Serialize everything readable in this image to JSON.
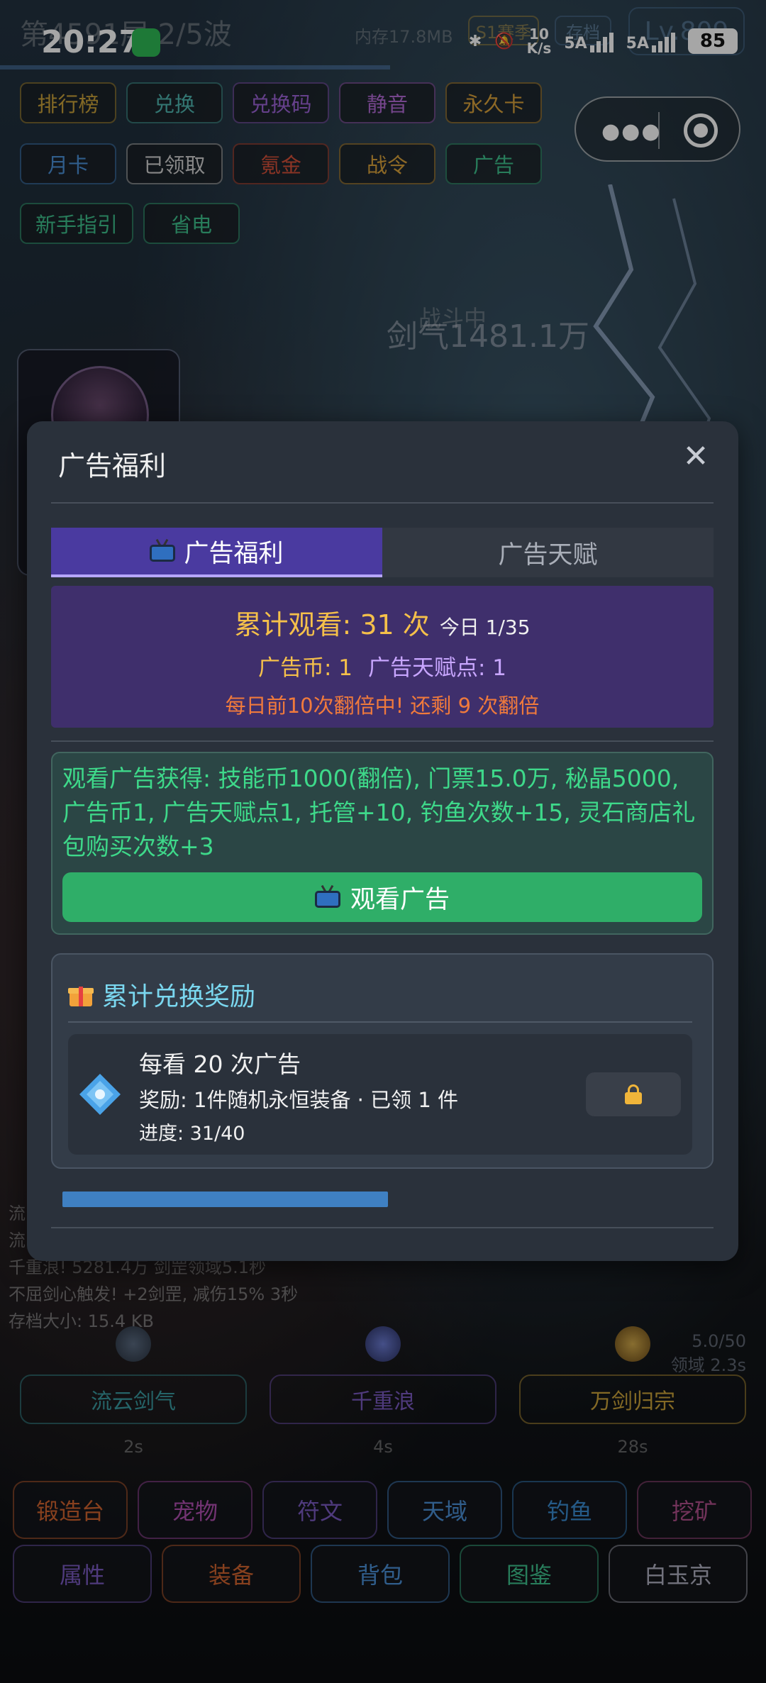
{
  "status_bar": {
    "time": "20:27",
    "network_speed_top": "10",
    "network_speed_unit": "K/s",
    "sim1": "5A",
    "sim2": "5A",
    "battery": "85"
  },
  "game_header": {
    "floor_wave": "第4591层 2/5波",
    "memory": "内存17.8MB",
    "season_chip": "S1赛季",
    "save_chip": "存档",
    "level_chip": "Lv.809"
  },
  "top_chips": {
    "row1": [
      {
        "label": "排行榜",
        "color": "#c9a23a"
      },
      {
        "label": "兑换",
        "color": "#4fb6b0"
      },
      {
        "label": "兑换码",
        "color": "#9b63d6"
      },
      {
        "label": "静音",
        "color": "#b36bd6"
      },
      {
        "label": "永久卡",
        "color": "#d9a13b"
      }
    ],
    "row2": [
      {
        "label": "月卡",
        "color": "#4a8fd6"
      },
      {
        "label": "已领取",
        "color": "#d0d0d0"
      },
      {
        "label": "氪金",
        "color": "#d6503a"
      },
      {
        "label": "战令",
        "color": "#d9a13b"
      },
      {
        "label": "广告",
        "color": "#3ec08c"
      }
    ],
    "row3": [
      {
        "label": "新手指引",
        "color": "#3ec08c"
      },
      {
        "label": "省电",
        "color": "#3ec08c"
      }
    ]
  },
  "battle": {
    "status": "战斗中",
    "sword_qi": "剑气1481.1万"
  },
  "log_lines": [
    "流",
    "流",
    "千重浪! 5281.4万 剑罡领域5.1秒",
    "不屈剑心触发! +2剑罡, 减伤15% 3秒",
    "存档大小: 15.4 KB"
  ],
  "skills": [
    {
      "name": "流云剑气",
      "cooldown": "2s",
      "color": "#3a9aa0"
    },
    {
      "name": "千重浪",
      "cooldown": "4s",
      "color": "#7a5ac0"
    },
    {
      "name": "万剑归宗",
      "cooldown": "28s",
      "color": "#c9a23a"
    }
  ],
  "skill_meta": {
    "value": "5.0/50",
    "domain": "领域 2.3s"
  },
  "bottom_nav": {
    "row1": [
      {
        "label": "锻造台",
        "color": "#d0632f"
      },
      {
        "label": "宠物",
        "color": "#b04fb0"
      },
      {
        "label": "符文",
        "color": "#7a5ac0"
      },
      {
        "label": "天域",
        "color": "#4a8fd6"
      },
      {
        "label": "钓鱼",
        "color": "#3a8ad0"
      },
      {
        "label": "挖矿",
        "color": "#b04f8a"
      }
    ],
    "row2": [
      {
        "label": "属性",
        "color": "#7a5ac0"
      },
      {
        "label": "装备",
        "color": "#d0632f"
      },
      {
        "label": "背包",
        "color": "#4a8fd6"
      },
      {
        "label": "图鉴",
        "color": "#3ec08c"
      },
      {
        "label": "白玉京",
        "color": "#b0b0c0"
      }
    ]
  },
  "modal": {
    "title": "广告福利",
    "close_icon": "close-icon",
    "tabs": [
      {
        "label": "广告福利",
        "active": true
      },
      {
        "label": "广告天赋",
        "active": false
      }
    ],
    "stats": {
      "cumulative_watch": "累计观看: 31 次",
      "today": "今日 1/35",
      "ad_coin": "广告币: 1",
      "talent_points": "广告天赋点: 1",
      "double_notice": "每日前10次翻倍中! 还剩 9 次翻倍"
    },
    "reward": {
      "description": "观看广告获得: 技能币1000(翻倍), 门票15.0万, 秘晶5000, 广告币1, 广告天赋点1, 托管+10, 钓鱼次数+15, 灵石商店礼包购买次数+3",
      "watch_button": "观看广告"
    },
    "exchange": {
      "title": "累计兑换奖励",
      "item": {
        "title": "每看 20 次广告",
        "reward": "奖励: 1件随机永恒装备 · 已领 1 件",
        "progress_text": "进度: 31/40",
        "progress_fraction": 0.775,
        "locked": true
      }
    },
    "colors": {
      "tab_active": "#4a3aa0",
      "stats_bg": "#3f2f6c",
      "gold": "#f5c04a",
      "reward_green": "#3ed98a",
      "button_green": "#2fae68",
      "bar_blue": "#3f80c2"
    }
  }
}
